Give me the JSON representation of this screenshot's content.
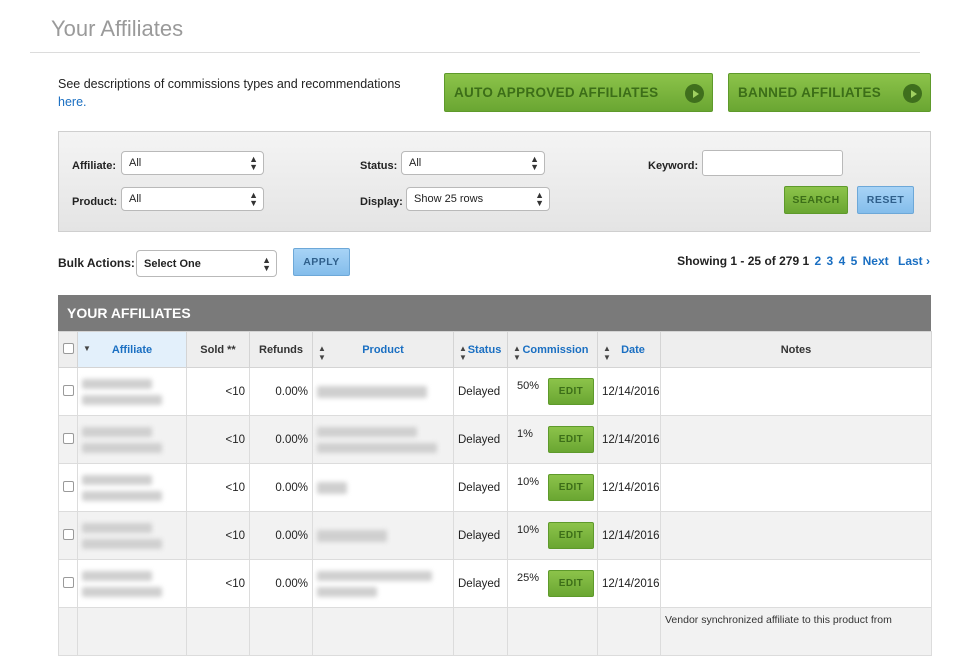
{
  "page": {
    "title": "Your Affiliates"
  },
  "description": {
    "text": "See descriptions of commissions types and recommendations",
    "link": "here."
  },
  "top_buttons": {
    "auto_approved": "AUTO APPROVED AFFILIATES",
    "banned": "BANNED AFFILIATES"
  },
  "colors": {
    "green": "#7ab83e",
    "blue_button": "#93c7f0",
    "link": "#1a6fc2",
    "header_bar": "#7a7a7a"
  },
  "filters": {
    "affiliate_label": "Affiliate:",
    "affiliate_value": "All",
    "status_label": "Status:",
    "status_value": "All",
    "keyword_label": "Keyword:",
    "keyword_value": "",
    "product_label": "Product:",
    "product_value": "All",
    "display_label": "Display:",
    "display_value": "Show 25 rows",
    "search_label": "SEARCH",
    "reset_label": "RESET"
  },
  "bulk": {
    "label": "Bulk Actions:",
    "value": "Select One",
    "apply_label": "APPLY"
  },
  "paging": {
    "showing": "Showing 1 - 25 of 279",
    "current": "1",
    "pages": [
      "2",
      "3",
      "4",
      "5"
    ],
    "next": "Next",
    "last": "Last ›"
  },
  "table": {
    "title": "YOUR AFFILIATES",
    "columns": {
      "affiliate": "Affiliate",
      "sold": "Sold **",
      "refunds": "Refunds",
      "product": "Product",
      "status": "Status",
      "commission": "Commission",
      "date": "Date",
      "notes": "Notes"
    },
    "edit_label": "EDIT",
    "rows": [
      {
        "sold": "<10",
        "refunds": "0.00%",
        "status": "Delayed",
        "commission": "50%",
        "date": "12/14/2016",
        "notes": ""
      },
      {
        "sold": "<10",
        "refunds": "0.00%",
        "status": "Delayed",
        "commission": "1%",
        "date": "12/14/2016",
        "notes": ""
      },
      {
        "sold": "<10",
        "refunds": "0.00%",
        "status": "Delayed",
        "commission": "10%",
        "date": "12/14/2016",
        "notes": ""
      },
      {
        "sold": "<10",
        "refunds": "0.00%",
        "status": "Delayed",
        "commission": "10%",
        "date": "12/14/2016",
        "notes": ""
      },
      {
        "sold": "<10",
        "refunds": "0.00%",
        "status": "Delayed",
        "commission": "25%",
        "date": "12/14/2016",
        "notes": ""
      }
    ],
    "partial_row_note": "Vendor synchronized affiliate to this product from"
  }
}
